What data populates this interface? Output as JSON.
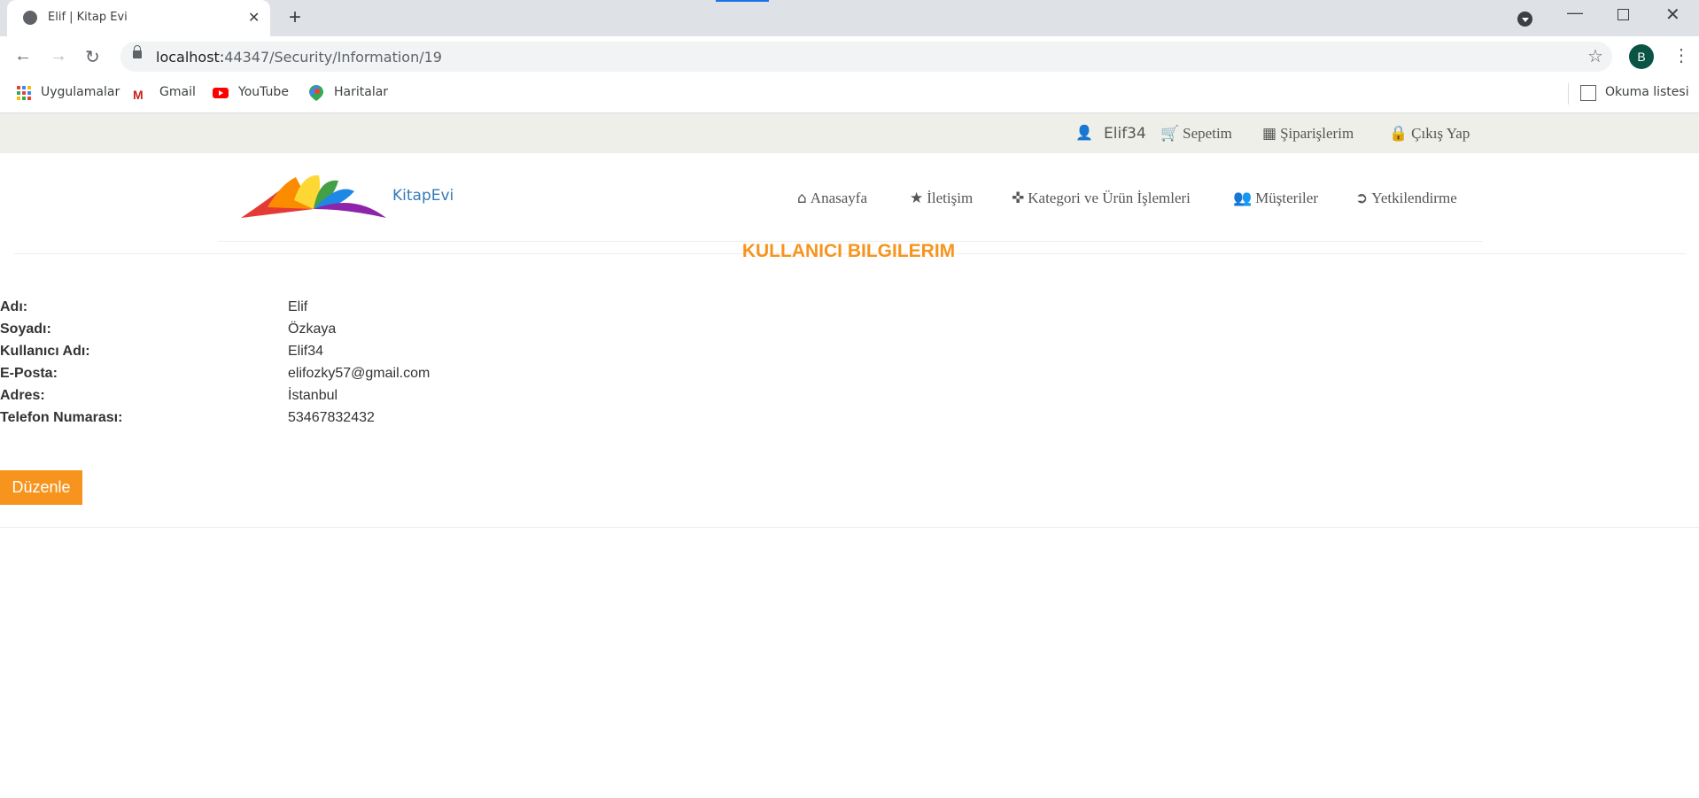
{
  "browser": {
    "tab_title": "Elif | Kitap Evi",
    "url_host": "localhost:",
    "url_path": "44347/Security/Information/19",
    "profile_initial": "B",
    "bookmarks": [
      "Uygulamalar",
      "Gmail",
      "YouTube",
      "Haritalar"
    ],
    "reading_list": "Okuma listesi"
  },
  "site": {
    "username": "Elif34",
    "top_links": {
      "cart": "Sepetim",
      "orders": "Şiparişlerim",
      "logout": "Çıkış Yap"
    },
    "brand": "KitapEvi",
    "nav": {
      "home": "Anasayfa",
      "contact": "İletişim",
      "category": "Kategori ve Ürün İşlemleri",
      "customers": "Müşteriler",
      "auth": "Yetkilendirme"
    }
  },
  "page": {
    "title": "KULLANICI BILGILERIM",
    "fields": [
      {
        "label": "Adı:",
        "value": "Elif"
      },
      {
        "label": "Soyadı:",
        "value": "Özkaya"
      },
      {
        "label": "Kullanıcı Adı:",
        "value": "Elif34"
      },
      {
        "label": "E-Posta:",
        "value": "elifozky57@gmail.com"
      },
      {
        "label": "Adres:",
        "value": "İstanbul"
      },
      {
        "label": "Telefon Numarası:",
        "value": "53467832432"
      }
    ],
    "edit_button": "Düzenle"
  },
  "colors": {
    "accent": "#f7941d",
    "brand_link": "#337ab7",
    "topbar_bg": "#efefe9"
  }
}
